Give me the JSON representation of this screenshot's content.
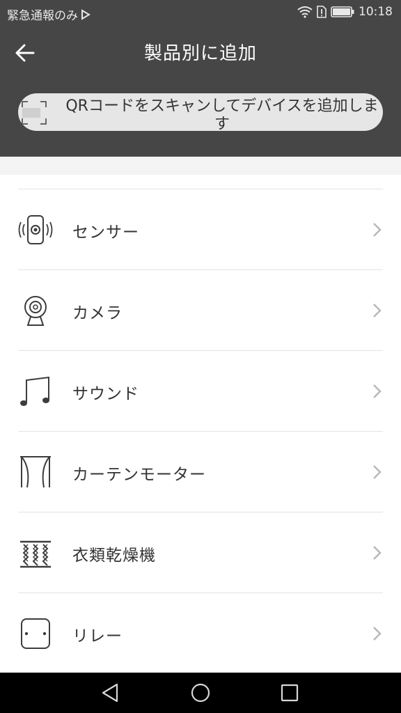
{
  "statusbar": {
    "carrier": "緊急通報のみ",
    "time": "10:18"
  },
  "header": {
    "title": "製品別に追加",
    "scan_label": "QRコードをスキャンしてデバイスを追加します"
  },
  "categories": [
    {
      "label": "センサー",
      "icon": "sensor-icon"
    },
    {
      "label": "カメラ",
      "icon": "camera-icon"
    },
    {
      "label": "サウンド",
      "icon": "music-note-icon"
    },
    {
      "label": "カーテンモーター",
      "icon": "curtain-icon"
    },
    {
      "label": "衣類乾燥機",
      "icon": "clothes-dryer-icon"
    },
    {
      "label": "リレー",
      "icon": "relay-icon"
    }
  ],
  "colors": {
    "appbar": "#464646",
    "icon_stroke": "#3c3c3c",
    "chevron": "#b8b8b8",
    "divider": "#e3e3e3"
  }
}
